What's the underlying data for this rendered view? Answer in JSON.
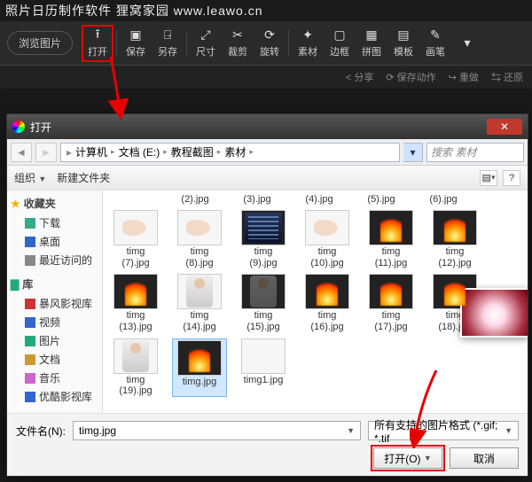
{
  "caption": "照片日历制作软件  狸窝家园  www.leawo.cn",
  "toolbar": {
    "browse": "浏览图片",
    "items": [
      {
        "label": "打开",
        "icon": "open"
      },
      {
        "label": "保存",
        "icon": "save"
      },
      {
        "label": "另存",
        "icon": "saveas"
      },
      {
        "label": "尺寸",
        "icon": "size"
      },
      {
        "label": "裁剪",
        "icon": "crop"
      },
      {
        "label": "旋转",
        "icon": "rotate"
      },
      {
        "label": "素材",
        "icon": "assets"
      },
      {
        "label": "边框",
        "icon": "frame"
      },
      {
        "label": "拼图",
        "icon": "collage"
      },
      {
        "label": "模板",
        "icon": "template"
      },
      {
        "label": "画笔",
        "icon": "brush"
      }
    ]
  },
  "secondbar": {
    "share": "分享",
    "saveact": "保存动作",
    "undo": "重做",
    "compare": "还原"
  },
  "dialog": {
    "title": "打开",
    "breadcrumb": [
      "计算机",
      "文档 (E:)",
      "教程截图",
      "素材"
    ],
    "searchPlaceholder": "搜索 素材",
    "organize": "组织",
    "newFolder": "新建文件夹",
    "sidebar": {
      "favorites": {
        "head": "收藏夹",
        "items": [
          "下载",
          "桌面",
          "最近访问的"
        ]
      },
      "lib": {
        "head": "库",
        "items": [
          "暴风影视库",
          "视频",
          "图片",
          "文档",
          "音乐",
          "优酷影视库"
        ]
      }
    },
    "firstRow": [
      "(2).jpg",
      "(3).jpg",
      "(4).jpg",
      "(5).jpg",
      "(6).jpg"
    ],
    "files": [
      {
        "name": "timg (7).jpg",
        "kind": "hand"
      },
      {
        "name": "timg (8).jpg",
        "kind": "hand"
      },
      {
        "name": "timg (9).jpg",
        "kind": "building"
      },
      {
        "name": "timg (10).jpg",
        "kind": "hand"
      },
      {
        "name": "timg (11).jpg",
        "kind": "flame"
      },
      {
        "name": "timg (12).jpg",
        "kind": "flame"
      },
      {
        "name": "timg (13).jpg",
        "kind": "flame"
      },
      {
        "name": "timg (14).jpg",
        "kind": "person"
      },
      {
        "name": "timg (15).jpg",
        "kind": "person-dark"
      },
      {
        "name": "timg (16).jpg",
        "kind": "flame"
      },
      {
        "name": "timg (17).jpg",
        "kind": "flame"
      },
      {
        "name": "timg (18).jpg",
        "kind": "flame"
      },
      {
        "name": "timg (19).jpg",
        "kind": "person"
      },
      {
        "name": "timg.jpg",
        "kind": "flame",
        "selected": true
      },
      {
        "name": "timg1.jpg",
        "kind": "light"
      }
    ],
    "filenameLabel": "文件名(N):",
    "filenameValue": "timg.jpg",
    "filterValue": "所有支持的图片格式 (*.gif; *.tif",
    "openBtn": "打开(O)",
    "cancelBtn": "取消"
  }
}
